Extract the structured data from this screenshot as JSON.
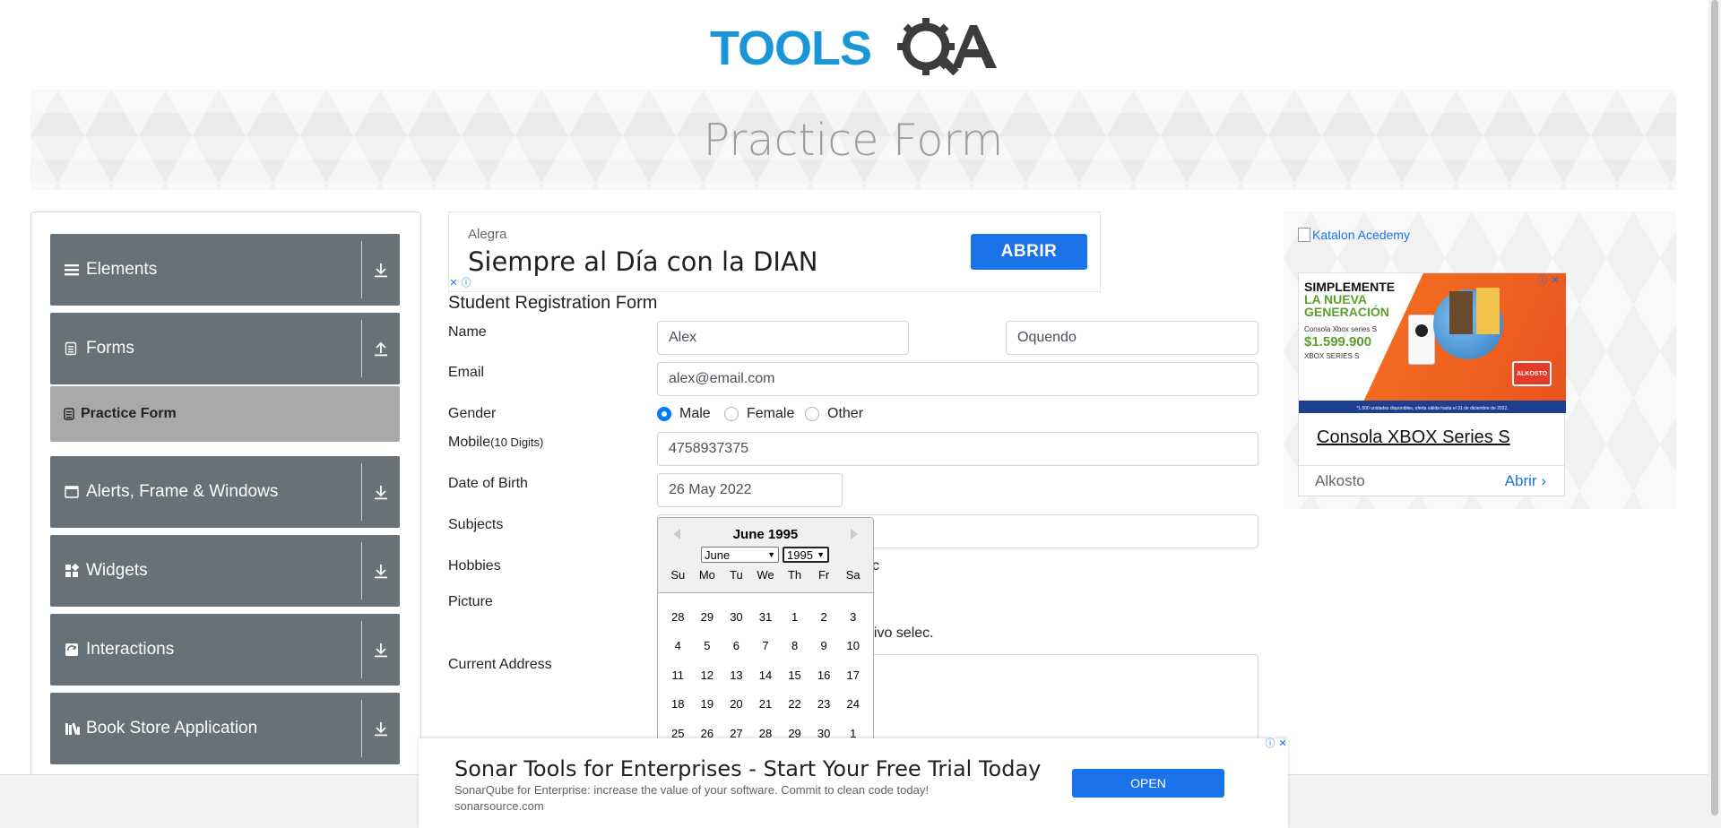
{
  "header": {
    "logo_text": "TOOLSQA",
    "page_title": "Practice Form"
  },
  "sidebar": {
    "groups": [
      {
        "label": "Elements",
        "icon": "list-icon",
        "arrow": "download-arrow-icon"
      },
      {
        "label": "Forms",
        "icon": "form-icon",
        "arrow": "upload-arrow-icon"
      },
      {
        "label": "Alerts, Frame & Windows",
        "icon": "window-icon",
        "arrow": "download-arrow-icon"
      },
      {
        "label": "Widgets",
        "icon": "widgets-icon",
        "arrow": "download-arrow-icon"
      },
      {
        "label": "Interactions",
        "icon": "interactions-icon",
        "arrow": "download-arrow-icon"
      },
      {
        "label": "Book Store Application",
        "icon": "books-icon",
        "arrow": "download-arrow-icon"
      }
    ],
    "active_item": {
      "label": "Practice Form",
      "icon": "form-icon"
    }
  },
  "top_ad": {
    "advertiser": "Alegra",
    "headline": "Siempre al Día con la DIAN",
    "button": "ABRIR"
  },
  "form": {
    "title": "Student Registration Form",
    "labels": {
      "name": "Name",
      "email": "Email",
      "gender": "Gender",
      "mobile": "Mobile",
      "mobile_hint": "(10 Digits)",
      "dob": "Date of Birth",
      "subjects": "Subjects",
      "hobbies": "Hobbies",
      "picture": "Picture",
      "address": "Current Address"
    },
    "first_name": "Alex",
    "last_name": "Oquendo",
    "email": "alex@email.com",
    "gender_options": [
      "Male",
      "Female",
      "Other"
    ],
    "gender_selected": "Male",
    "mobile": "4758937375",
    "dob": "26 May 2022",
    "hobbies_partial": "c",
    "picture_partial": "hivo selec."
  },
  "datepicker": {
    "title": "June 1995",
    "month_select": "June",
    "year_select": "1995",
    "day_names": [
      "Su",
      "Mo",
      "Tu",
      "We",
      "Th",
      "Fr",
      "Sa"
    ],
    "days": [
      "28",
      "29",
      "30",
      "31",
      "1",
      "2",
      "3",
      "4",
      "5",
      "6",
      "7",
      "8",
      "9",
      "10",
      "11",
      "12",
      "13",
      "14",
      "15",
      "16",
      "17",
      "18",
      "19",
      "20",
      "21",
      "22",
      "23",
      "24",
      "25",
      "26",
      "27",
      "28",
      "29",
      "30",
      "1"
    ]
  },
  "right_ad": {
    "broken_image_alt": "Katalon Acedemy",
    "promo": {
      "line1": "SIMPLEMENTE",
      "line2": "LA NUEVA",
      "line3": "GENERACIÓN",
      "product": "Consola Xbox series S",
      "price": "$1.599.900",
      "brand": "XBOX SERIES S",
      "store_badge": "ALKOSTO",
      "fine_print": "*1.500 unidades disponibles, oferta válida hasta el 31 de diciembre de 2022."
    },
    "title": "Consola XBOX Series S",
    "shop": "Alkosto",
    "open": "Abrir"
  },
  "bottom_ad": {
    "headline": "Sonar Tools for Enterprises - Start Your Free Trial Today",
    "description": "SonarQube for Enterprise: increase the value of your software. Commit to clean code today!",
    "site": "sonarsource.com",
    "button": "OPEN"
  }
}
